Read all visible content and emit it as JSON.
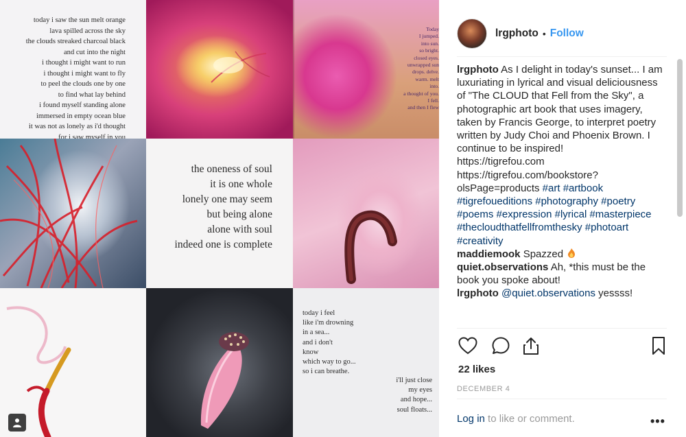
{
  "grid": {
    "poem1": "today i saw the sun melt orange\nlava spilled across the sky\nthe clouds streaked charcoal black\nand cut into the night\ni thought i might want to run\ni thought i might want to fly\nto peel the clouds one by one\nto find what lay behind\ni found myself standing alone\nimmersed in empty ocean blue\nit was not as lonely as i'd thought\nfor i saw myself in you",
    "poem2": "the oneness of soul\nit is one whole\nlonely one may seem\nbut being alone\nalone with soul\nindeed one is complete",
    "poem3": "today i feel\nlike i'm drowning\nin a sea...\nand i don't\nknow\nwhich way to go...\nso i can breathe.",
    "poem4": "i'll just close\nmy eyes\nand hope...\nsoul floats...",
    "poem5": "Today\nI jumped.\ninto sun.\nso bright.\nclosed eyes.\nunwrapped sun\ndrops. delve.\nwarm. melt\ninto.\na thought of you.\nI fell.\nand then I flew"
  },
  "header": {
    "username": "lrgphoto",
    "dot": "•",
    "follow_label": "Follow"
  },
  "caption": {
    "username": "lrgphoto",
    "text": " As I delight in today's sunset... I am luxuriating in lyrical and visual deliciousness of \"The CLOUD that Fell from the Sky\", a photographic art book that uses imagery, taken by Francis George, to interpret poetry written by Judy Choi and Phoenix Brown. I continue to be inspired!",
    "link1": "https://tigrefou.com",
    "link2": "https://tigrefou.com/bookstore?olsPage=products",
    "hashtags": [
      "#art",
      "#artbook",
      "#tigrefoueditions",
      "#photography",
      "#poetry",
      "#poems",
      "#expression",
      "#lyrical",
      "#masterpiece",
      "#thecloudthatfellfromthesky",
      "#photoart",
      "#creativity"
    ]
  },
  "comments": [
    {
      "user": "maddiemook",
      "text": " Spazzed "
    },
    {
      "user": "quiet.observations",
      "text": " Ah, *this must be the book you spoke about!"
    },
    {
      "user": "lrgphoto",
      "mention": "@quiet.observations",
      "text": " yessss!"
    }
  ],
  "actions": {
    "like_icon": "heart-outline-icon",
    "comment_icon": "comment-bubble-icon",
    "share_icon": "share-upload-icon",
    "save_icon": "bookmark-icon"
  },
  "likes": "22 likes",
  "date": "DECEMBER 4",
  "login": {
    "link": "Log in",
    "text": " to like or comment."
  },
  "more_label": "•••",
  "colors": {
    "link_blue": "#3897f0",
    "hashtag": "#003569",
    "muted": "#999999"
  }
}
